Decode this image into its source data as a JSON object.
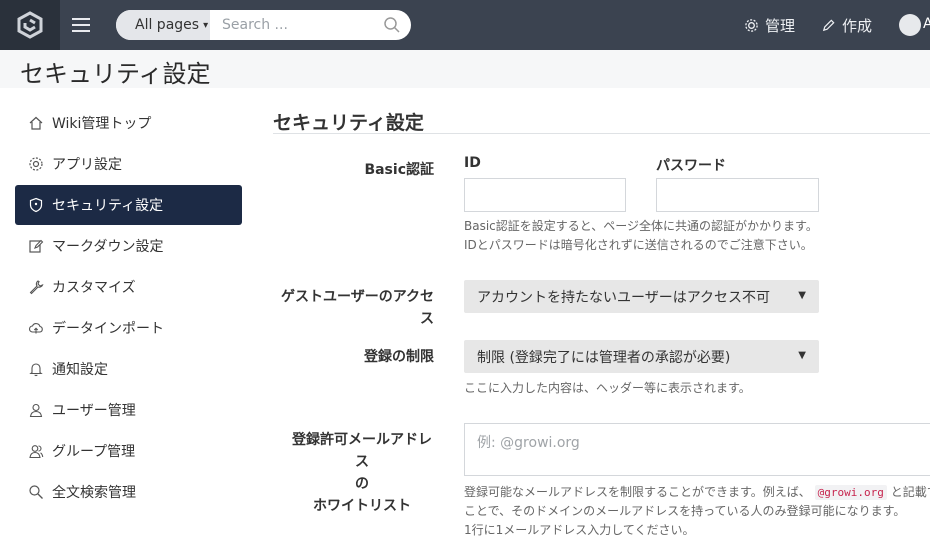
{
  "header": {
    "logo_icon": "growi-logo-icon",
    "menu_icon": "hamburger-icon",
    "search": {
      "scope_label": "All pages",
      "placeholder": "Search ..."
    },
    "admin_label": "管理",
    "create_label": "作成",
    "user_initial": "A"
  },
  "page": {
    "title": "セキュリティ設定"
  },
  "sidebar": {
    "items": [
      {
        "label": "Wiki管理トップ",
        "icon": "home-icon"
      },
      {
        "label": "アプリ設定",
        "icon": "gear-icon"
      },
      {
        "label": "セキュリティ設定",
        "icon": "shield-icon",
        "active": true
      },
      {
        "label": "マークダウン設定",
        "icon": "edit-icon"
      },
      {
        "label": "カスタマイズ",
        "icon": "wrench-icon"
      },
      {
        "label": "データインポート",
        "icon": "cloud-upload-icon"
      },
      {
        "label": "通知設定",
        "icon": "bell-icon"
      },
      {
        "label": "ユーザー管理",
        "icon": "user-icon"
      },
      {
        "label": "グループ管理",
        "icon": "users-icon"
      },
      {
        "label": "全文検索管理",
        "icon": "search-icon"
      }
    ]
  },
  "main": {
    "heading": "セキュリティ設定",
    "basic_auth": {
      "label": "Basic認証",
      "id_label": "ID",
      "id_value": "",
      "password_label": "パスワード",
      "password_value": "",
      "help_line1": "Basic認証を設定すると、ページ全体に共通の認証がかかります。",
      "help_line2": "IDとパスワードは暗号化されずに送信されるのでご注意下さい。"
    },
    "guest_access": {
      "label_line1": "ゲストユーザーのアクセ",
      "label_line2": "ス",
      "selected": "アカウントを持たないユーザーはアクセス不可"
    },
    "registration": {
      "label": "登録の制限",
      "selected": "制限 (登録完了には管理者の承認が必要)",
      "help": "ここに入力した内容は、ヘッダー等に表示されます。"
    },
    "whitelist": {
      "label_line1": "登録許可メールアドレス",
      "label_line2": "の",
      "label_line3": "ホワイトリスト",
      "placeholder": "例: @growi.org",
      "help_line1_a": "登録可能なメールアドレスを制限することができます。例えば、",
      "help_code": "@growi.org",
      "help_line1_b": "と記載すると",
      "help_line2": "ことで、そのドメインのメールアドレスを持っている人のみ登録可能になります。",
      "help_line3": "1行に1メールアドレス入力してください。"
    }
  }
}
